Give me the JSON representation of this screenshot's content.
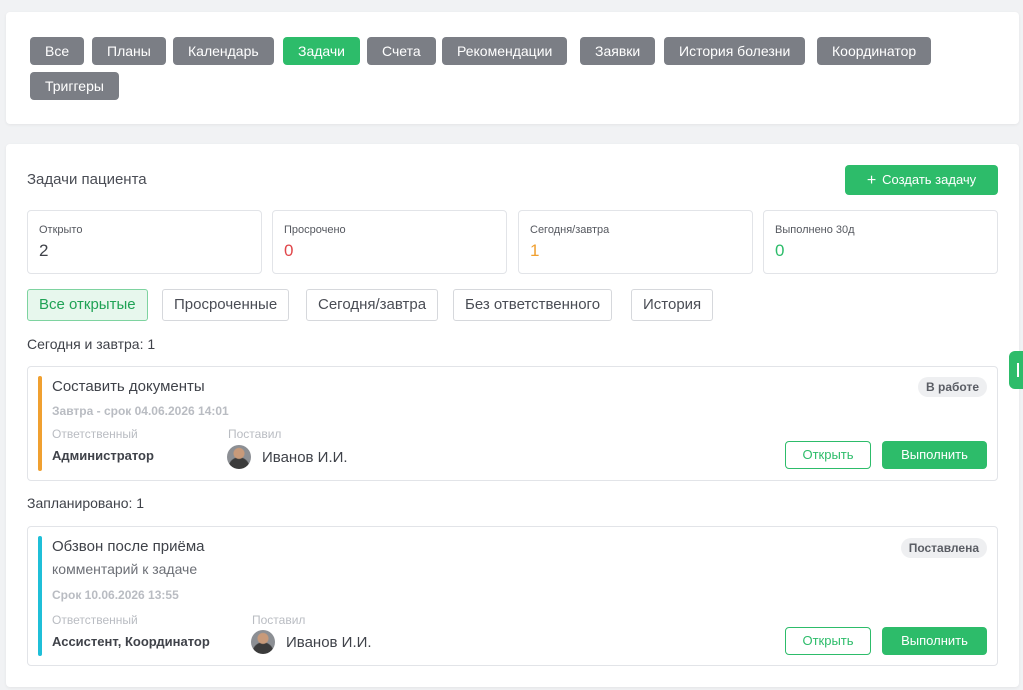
{
  "nav": {
    "tabs": [
      {
        "label": "Все"
      },
      {
        "label": "Планы"
      },
      {
        "label": "Календарь"
      },
      {
        "label": "Задачи",
        "active": true
      },
      {
        "label": "Счета"
      },
      {
        "label": "Рекомендации"
      },
      {
        "label": "Заявки"
      },
      {
        "label": "История болезни"
      },
      {
        "label": "Координатор"
      },
      {
        "label": "Триггеры"
      }
    ]
  },
  "tasks_panel": {
    "title": "Задачи пациента",
    "create_button": {
      "icon": "plus-icon",
      "label": "Создать задачу"
    },
    "stats": [
      {
        "label": "Открыто",
        "value": "2",
        "color": "#3f4249"
      },
      {
        "label": "Просрочено",
        "value": "0",
        "color": "#e0464a"
      },
      {
        "label": "Сегодня/завтра",
        "value": "1",
        "color": "#f0a030"
      },
      {
        "label": "Выполнено 30д",
        "value": "0",
        "color": "#2dbc6a"
      }
    ],
    "filters": [
      {
        "label": "Все открытые",
        "active": true
      },
      {
        "label": "Просроченные"
      },
      {
        "label": "Сегодня/завтра"
      },
      {
        "label": "Без ответственного"
      },
      {
        "label": "История"
      }
    ],
    "groups": [
      {
        "label": "Сегодня и завтра: 1",
        "tasks": [
          {
            "title": "Составить документы",
            "comment": "",
            "due": "Завтра - срок 04.06.2026 14:01",
            "status": "В работе",
            "accent_color": "#f0a030",
            "assignee_label": "Ответственный",
            "assignee": "Администратор",
            "creator_label": "Поставил",
            "creator": "Иванов И.И.",
            "open_label": "Открыть",
            "done_label": "Выполнить"
          }
        ]
      },
      {
        "label": "Запланировано: 1",
        "tasks": [
          {
            "title": "Обзвон после приёма",
            "comment": "комментарий к задаче",
            "due": "Срок 10.06.2026 13:55",
            "status": "Поставлена",
            "accent_color": "#1fbfd8",
            "assignee_label": "Ответственный",
            "assignee": "Ассистент, Координатор",
            "creator_label": "Поставил",
            "creator": "Иванов И.И.",
            "open_label": "Открыть",
            "done_label": "Выполнить"
          }
        ]
      }
    ]
  },
  "side_handle": {
    "icon": "collapse-handle-icon"
  },
  "colors": {
    "accent": "#2dbc6a",
    "nav_tab": "#7b7e85"
  }
}
